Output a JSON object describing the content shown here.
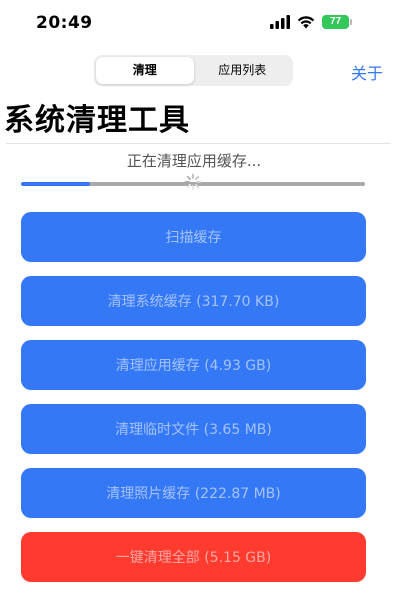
{
  "status_bar": {
    "time": "20:49",
    "battery_level": "77",
    "signal_icon": "cellular-signal-icon",
    "wifi_icon": "wifi-icon"
  },
  "nav": {
    "tabs": [
      {
        "label": "清理",
        "active": true
      },
      {
        "label": "应用列表",
        "active": false
      }
    ],
    "about_label": "关于"
  },
  "page": {
    "title": "系统清理工具"
  },
  "progress": {
    "status_text": "正在清理应用缓存...",
    "fraction": 0.2,
    "fill_color": "#3478f6",
    "track_color": "#a9a9a9"
  },
  "actions": [
    {
      "id": "scan",
      "label": "扫描缓存",
      "color": "#3478f6"
    },
    {
      "id": "system",
      "label": "清理系统缓存 (317.70 KB)",
      "color": "#3478f6"
    },
    {
      "id": "app",
      "label": "清理应用缓存 (4.93 GB)",
      "color": "#3478f6"
    },
    {
      "id": "temp",
      "label": "清理临时文件 (3.65 MB)",
      "color": "#3478f6"
    },
    {
      "id": "photo",
      "label": "清理照片缓存 (222.87 MB)",
      "color": "#3478f6"
    },
    {
      "id": "all",
      "label": "一键清理全部 (5.15 GB)",
      "color": "#ff3b30"
    }
  ]
}
